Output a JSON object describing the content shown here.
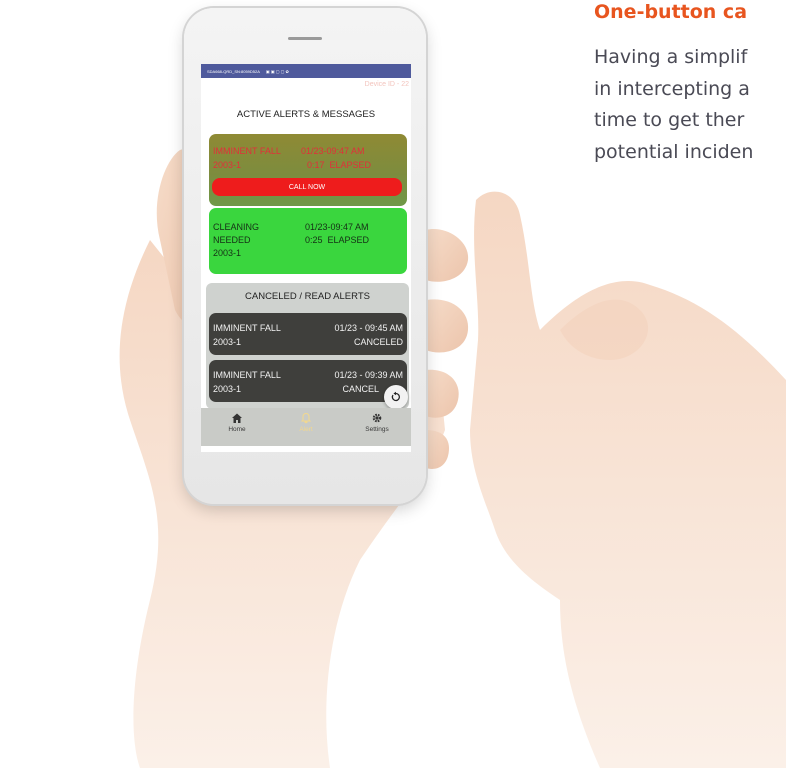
{
  "side": {
    "title": "One-button ca",
    "lines": [
      "Having a simplif",
      "in intercepting a",
      "time to get ther",
      "potential inciden"
    ]
  },
  "statusbar": {
    "text": "SDA668-QRD_SN:8059D52A",
    "icons": "▣ ▣ ▢ ▢ ✿"
  },
  "device_id": "Device ID - 22",
  "active_title": "ACTIVE ALERTS & MESSAGES",
  "alerts": [
    {
      "type": "IMMINENT FALL",
      "room": "2003-1",
      "datetime": "01/23-09:47 AM",
      "elapsed": "0:17  ELAPSED",
      "button": "CALL NOW",
      "color": "#8f8a34",
      "text_color": "#e0303a"
    },
    {
      "type_line1": "CLEANING",
      "type_line2": "NEEDED",
      "room": "2003-1",
      "datetime": "01/23-09:47 AM",
      "elapsed": "0:25  ELAPSED",
      "color": "#3ad63e"
    }
  ],
  "canceled_title": "CANCELED / READ ALERTS",
  "canceled": [
    {
      "type": "IMMINENT FALL",
      "room": "2003-1",
      "datetime": "01/23 - 09:45 AM",
      "status": "CANCELED"
    },
    {
      "type": "IMMINENT FALL",
      "room": "2003-1",
      "datetime": "01/23 - 09:39 AM",
      "status": "CANCEL"
    }
  ],
  "nav": {
    "home": "Home",
    "alerts": "Alert",
    "settings": "Settings"
  },
  "icons": {
    "refresh": "refresh-icon",
    "home": "home-icon",
    "bell": "bell-icon",
    "settings": "gear-icon"
  },
  "accent_color": "#e8551f"
}
